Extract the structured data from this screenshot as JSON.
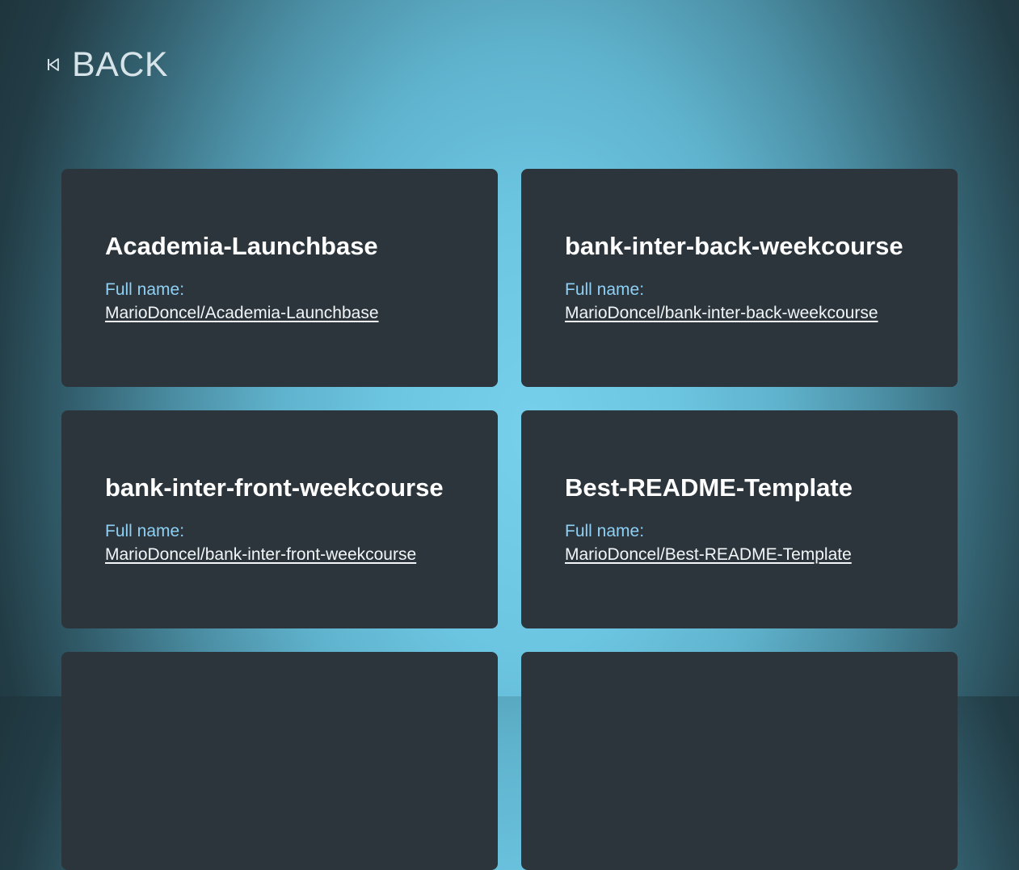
{
  "header": {
    "back_label": "BACK",
    "back_icon": "skip-back-icon"
  },
  "colors": {
    "card_background": "#2b353b",
    "label": "#8fd0f5",
    "title": "#ffffff",
    "back_text": "#d6e4e9"
  },
  "repos": [
    {
      "name": "Academia-Launchbase",
      "full_name_label": "Full name:",
      "full_name": "MarioDoncel/Academia-Launchbase"
    },
    {
      "name": "bank-inter-back-weekcourse",
      "full_name_label": "Full name:",
      "full_name": "MarioDoncel/bank-inter-back-weekcourse"
    },
    {
      "name": "bank-inter-front-weekcourse",
      "full_name_label": "Full name:",
      "full_name": "MarioDoncel/bank-inter-front-weekcourse"
    },
    {
      "name": "Best-README-Template",
      "full_name_label": "Full name:",
      "full_name": "MarioDoncel/Best-README-Template"
    }
  ]
}
